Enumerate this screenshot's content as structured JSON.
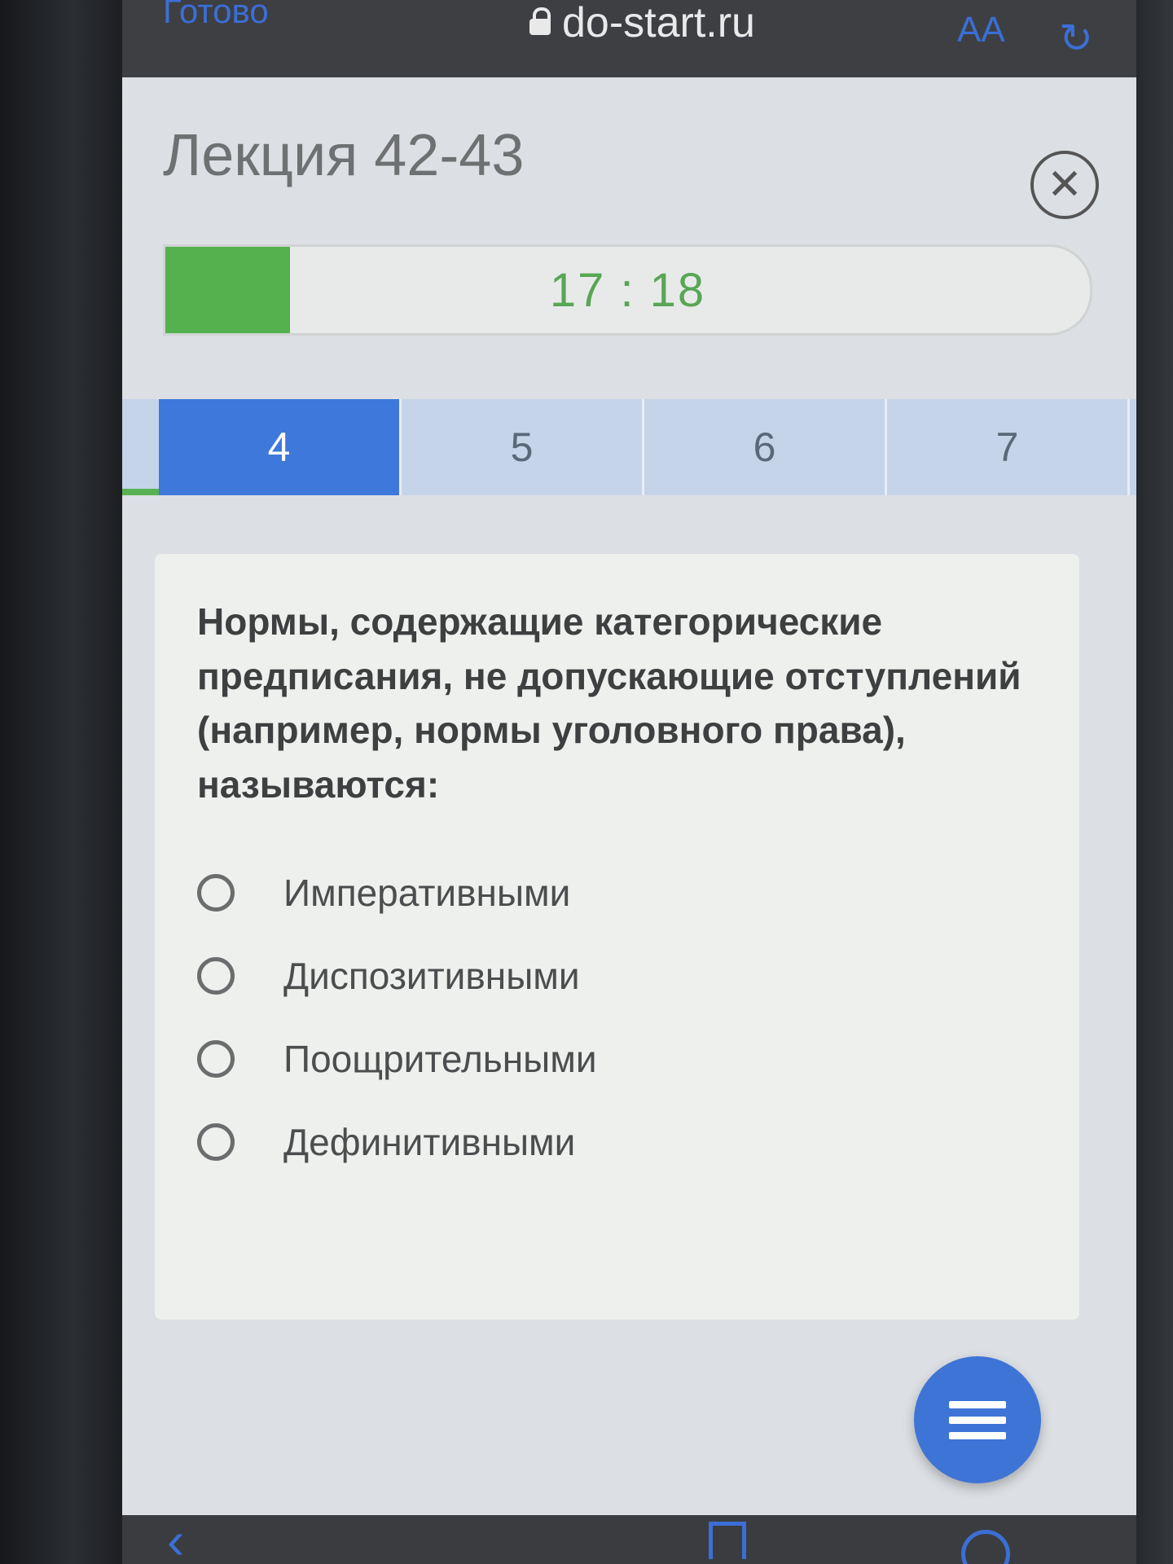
{
  "browser": {
    "done_label": "Готово",
    "url": "do-start.ru",
    "text_size_label": "AA"
  },
  "header": {
    "title": "Лекция 42-43"
  },
  "timer": {
    "value": "17 : 18",
    "progress_fraction": 0.135
  },
  "tabs": [
    "4",
    "5",
    "6",
    "7"
  ],
  "active_tab": "4",
  "question": {
    "text": "Нормы, содержащие категорические предписания, не допускающие отступлений (например, нормы уголовного права), называются:",
    "options": [
      "Императивными",
      "Диспозитивными",
      "Поощрительными",
      "Дефинитивными"
    ]
  },
  "colors": {
    "accent_blue": "#3e78da",
    "progress_green": "#55b04e",
    "timer_green": "#58a656"
  },
  "icons": {
    "lock": "lock-icon",
    "reload": "reload-icon",
    "close": "close-icon",
    "menu": "menu-icon",
    "back": "chevron-left-icon",
    "share": "share-icon",
    "compass": "compass-icon"
  }
}
